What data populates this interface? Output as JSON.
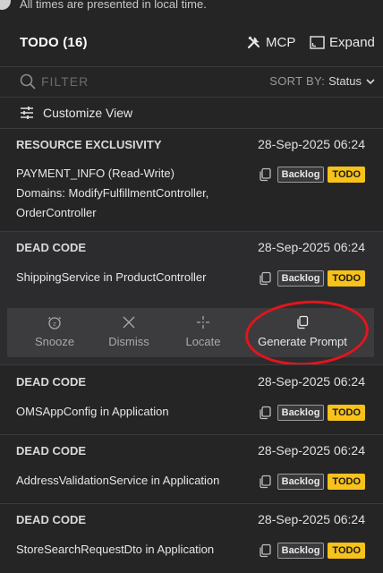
{
  "notice": "All times are presented in local time.",
  "header": {
    "title": "TODO (16)",
    "mcp_label": "MCP",
    "expand_label": "Expand"
  },
  "filter": {
    "placeholder": "FILTER",
    "value": ""
  },
  "sort": {
    "label": "SORT BY:",
    "value": "Status"
  },
  "customize_label": "Customize View",
  "items": [
    {
      "type": "RESOURCE EXCLUSIVITY",
      "date": "28-Sep-2025 06:24",
      "desc_lines": [
        "PAYMENT_INFO (Read-Write)",
        "Domains: ModifyFulfillmentController,",
        "OrderController"
      ],
      "backlog": "Backlog",
      "status": "TODO"
    },
    {
      "type": "DEAD CODE",
      "date": "28-Sep-2025 06:24",
      "desc_lines": [
        "ShippingService in ProductController"
      ],
      "backlog": "Backlog",
      "status": "TODO"
    },
    {
      "type": "DEAD CODE",
      "date": "28-Sep-2025 06:24",
      "desc_lines": [
        "OMSAppConfig in Application"
      ],
      "backlog": "Backlog",
      "status": "TODO"
    },
    {
      "type": "DEAD CODE",
      "date": "28-Sep-2025 06:24",
      "desc_lines": [
        "AddressValidationService in Application"
      ],
      "backlog": "Backlog",
      "status": "TODO"
    },
    {
      "type": "DEAD CODE",
      "date": "28-Sep-2025 06:24",
      "desc_lines": [
        "StoreSearchRequestDto in Application"
      ],
      "backlog": "Backlog",
      "status": "TODO"
    }
  ],
  "actions": {
    "snooze": "Snooze",
    "dismiss": "Dismiss",
    "locate": "Locate",
    "generate_prompt": "Generate Prompt"
  },
  "colors": {
    "background": "#252526",
    "todo_badge": "#f7c21a",
    "annotation_ring": "#e4141b"
  }
}
